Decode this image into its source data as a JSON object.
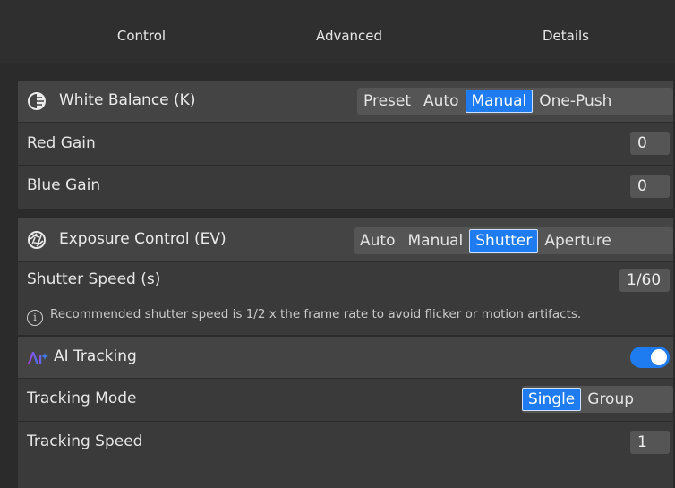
{
  "tabs": [
    {
      "label": "Control"
    },
    {
      "label": "Advanced"
    },
    {
      "label": "Details"
    }
  ],
  "active_tab": "Advanced",
  "accent_color": "#1e7bf0",
  "white_balance": {
    "title": "White Balance (K)",
    "icon": "white-balance-icon",
    "modes": [
      "Preset",
      "Auto",
      "Manual",
      "One-Push"
    ],
    "selected_mode": "Manual",
    "red_gain_label": "Red Gain",
    "red_gain_value": "0",
    "blue_gain_label": "Blue Gain",
    "blue_gain_value": "0"
  },
  "exposure": {
    "title": "Exposure Control (EV)",
    "icon": "exposure-icon",
    "modes": [
      "Auto",
      "Manual",
      "Shutter",
      "Aperture"
    ],
    "selected_mode": "Shutter",
    "shutter_speed_label": "Shutter Speed (s)",
    "shutter_speed_value": "1/60",
    "note": "Recommended shutter speed is 1/2 x the frame rate to avoid flicker or motion artifacts.",
    "note_icon": "info-icon"
  },
  "ai_tracking": {
    "badge": "Ai",
    "title": "AI Tracking",
    "enabled": true,
    "tracking_mode_label": "Tracking Mode",
    "tracking_modes": [
      "Single",
      "Group"
    ],
    "selected_tracking_mode": "Single",
    "tracking_speed_label": "Tracking Speed",
    "tracking_speed_value": "1"
  }
}
